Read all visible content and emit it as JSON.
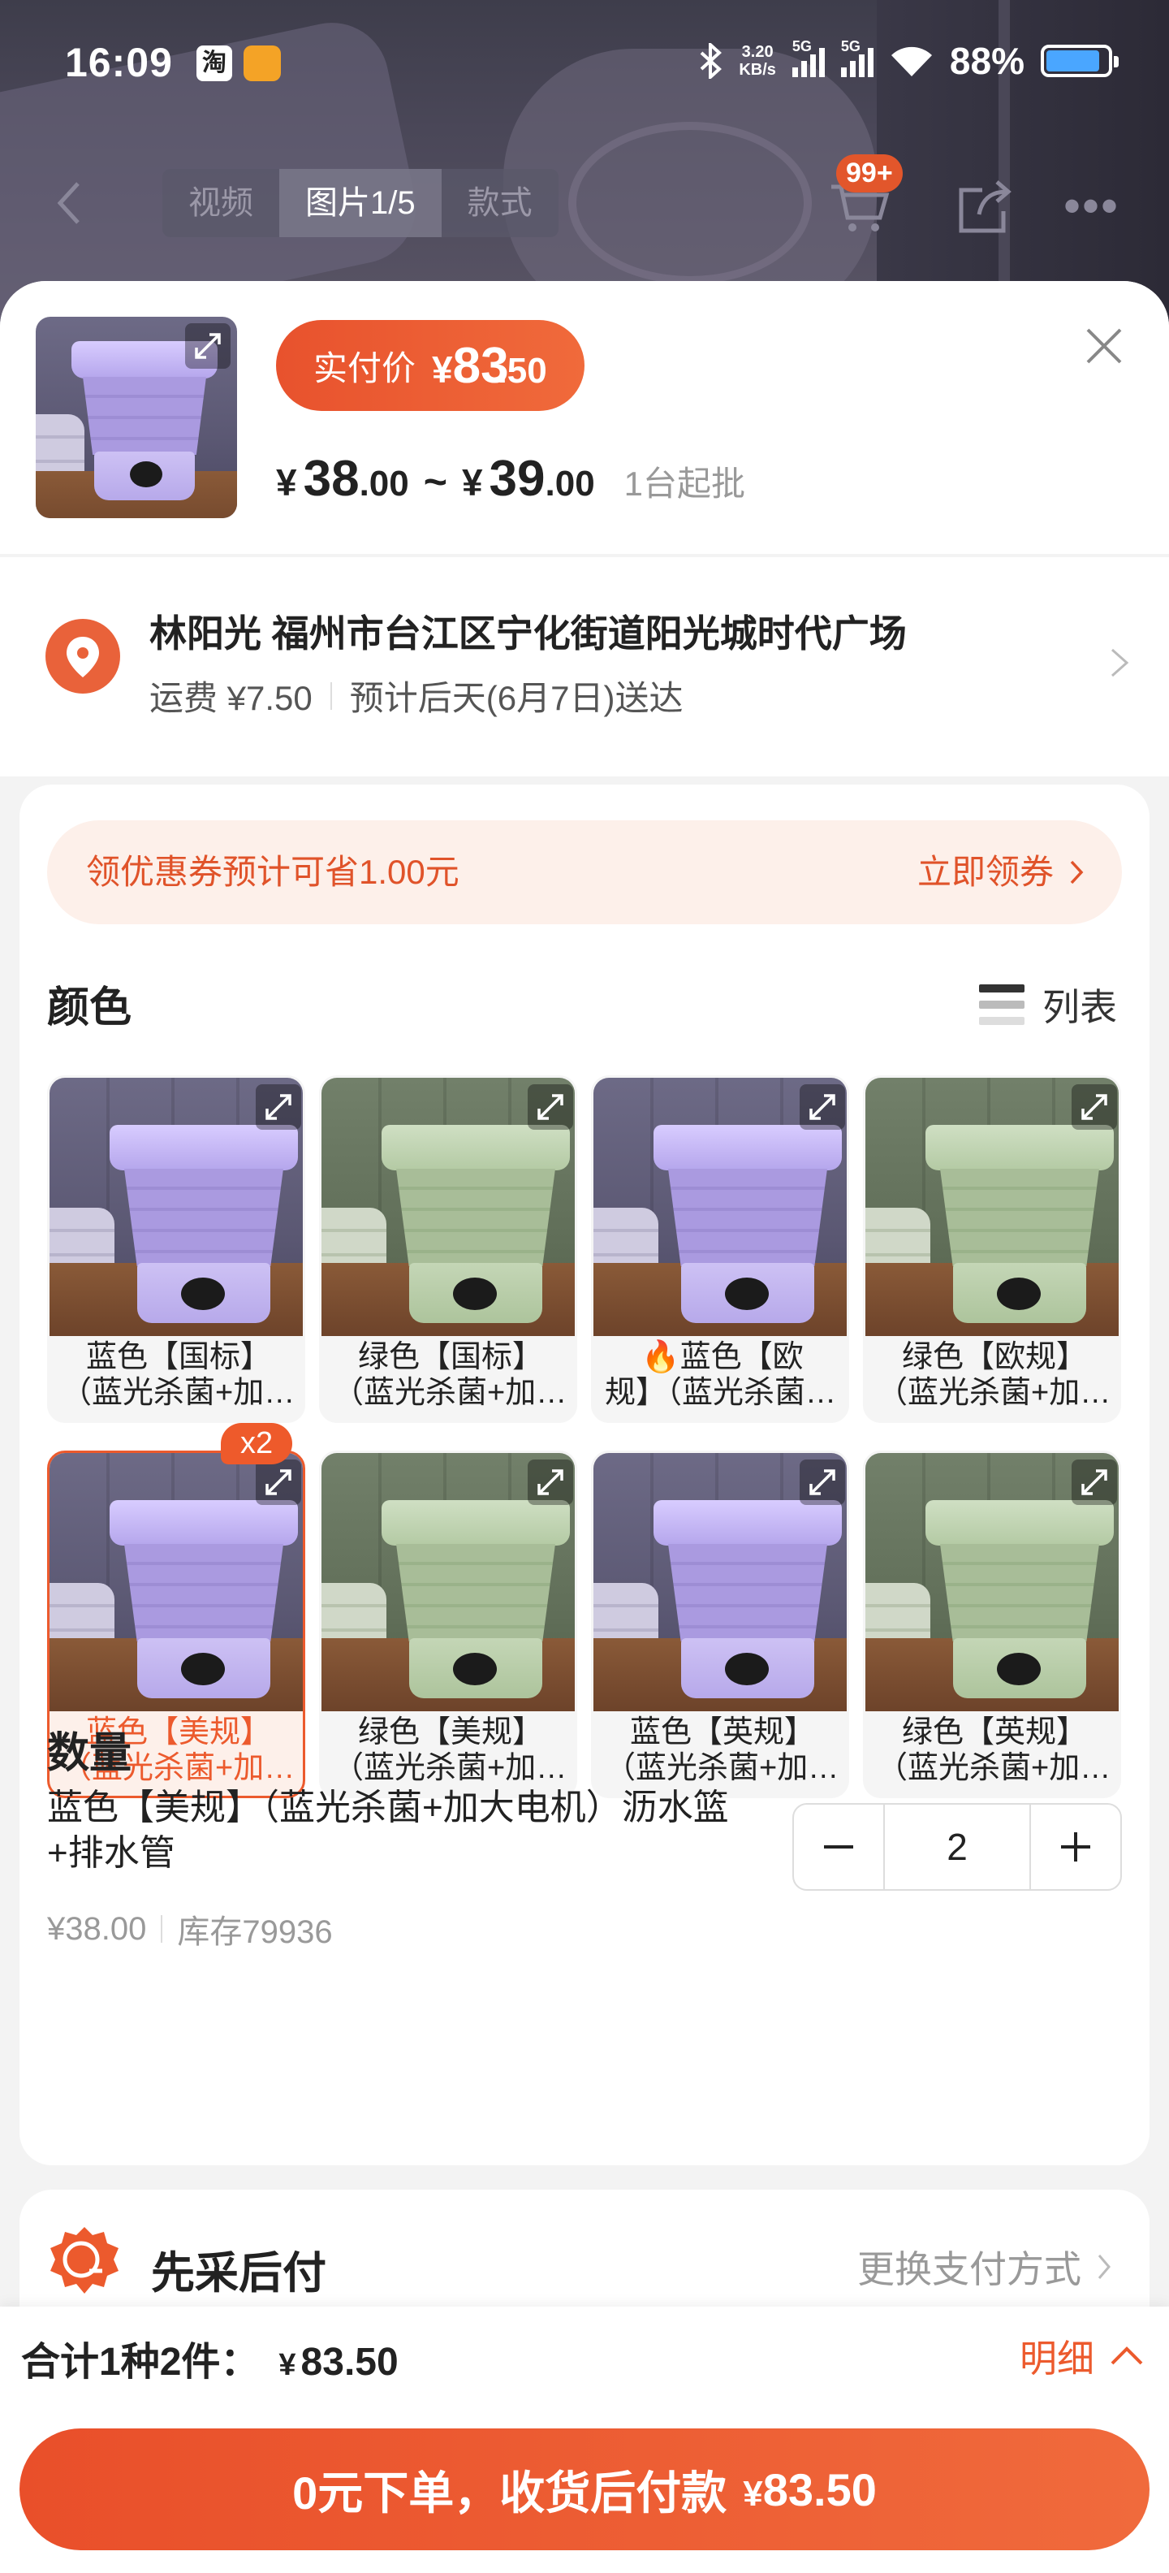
{
  "status_bar": {
    "time": "16:09",
    "app_icon_1": "淘",
    "net_speed_value": "3.20",
    "net_speed_unit": "KB/s",
    "signal_1": "5G",
    "signal_2": "5G",
    "battery": "88%",
    "battery_level": 0.88
  },
  "nav": {
    "tabs": [
      {
        "label": "视频",
        "active": false
      },
      {
        "label": "图片1/5",
        "active": true
      },
      {
        "label": "款式",
        "active": false
      }
    ],
    "cart_badge": "99+"
  },
  "price": {
    "pay_label": "实付价",
    "pay_yen": "¥",
    "pay_int": "83",
    "pay_dec": ".50",
    "range_low_int": "38",
    "range_low_dec": ".00",
    "range_high_int": "39",
    "range_high_dec": ".00",
    "yen": "¥",
    "tilde": "~",
    "moq": "1台起批"
  },
  "address": {
    "line1": "林阳光 福州市台江区宁化街道阳光城时代广场",
    "shipping": "运费 ¥7.50",
    "eta": "预计后天(6月7日)送达"
  },
  "coupon": {
    "text": "领优惠券预计可省1.00元",
    "action": "立即领券"
  },
  "color_section": {
    "title": "颜色",
    "view_toggle": "列表",
    "options": [
      {
        "line1": "蓝色【国标】",
        "line2": "（蓝光杀菌+加大电机）",
        "variant": "purple",
        "selected": false,
        "badge": "",
        "hot": false
      },
      {
        "line1": "绿色【国标】",
        "line2": "（蓝光杀菌+加大电机）",
        "variant": "green",
        "selected": false,
        "badge": "",
        "hot": false
      },
      {
        "line1": "蓝色【欧",
        "line2": "规】（蓝光杀菌+加大电机）",
        "variant": "purple",
        "selected": false,
        "badge": "",
        "hot": true
      },
      {
        "line1": "绿色【欧规】",
        "line2": "（蓝光杀菌+加大电机）",
        "variant": "green",
        "selected": false,
        "badge": "",
        "hot": false
      },
      {
        "line1": "蓝色【美规】",
        "line2": "（蓝光杀菌+加大电机）",
        "variant": "purple",
        "selected": true,
        "badge": "x2",
        "hot": false
      },
      {
        "line1": "绿色【美规】",
        "line2": "（蓝光杀菌+加大电机）",
        "variant": "green",
        "selected": false,
        "badge": "",
        "hot": false
      },
      {
        "line1": "蓝色【英规】",
        "line2": "（蓝光杀菌+加大电机）",
        "variant": "purple",
        "selected": false,
        "badge": "",
        "hot": false
      },
      {
        "line1": "绿色【英规】",
        "line2": "（蓝光杀菌+加大电机）",
        "variant": "green",
        "selected": false,
        "badge": "",
        "hot": false
      }
    ]
  },
  "quantity": {
    "title": "数量",
    "selected_desc": "蓝色【美规】（蓝光杀菌+加大电机）沥水篮+排水管",
    "unit_price": "¥38.00",
    "stock": "库存79936",
    "value": "2",
    "minus": "−",
    "plus": "+"
  },
  "payment": {
    "title": "先采后付",
    "change": "更换支付方式"
  },
  "footer": {
    "total_label": "合计1种2件：",
    "total_yen": "¥",
    "total_amount": "83.50",
    "detail": "明细",
    "order_text": "0元下单，收货后付款",
    "order_yen": "¥",
    "order_amount": "83.50"
  },
  "colors": {
    "accent": "#ec5a2d",
    "coupon_bg": "#fdf0ea"
  }
}
